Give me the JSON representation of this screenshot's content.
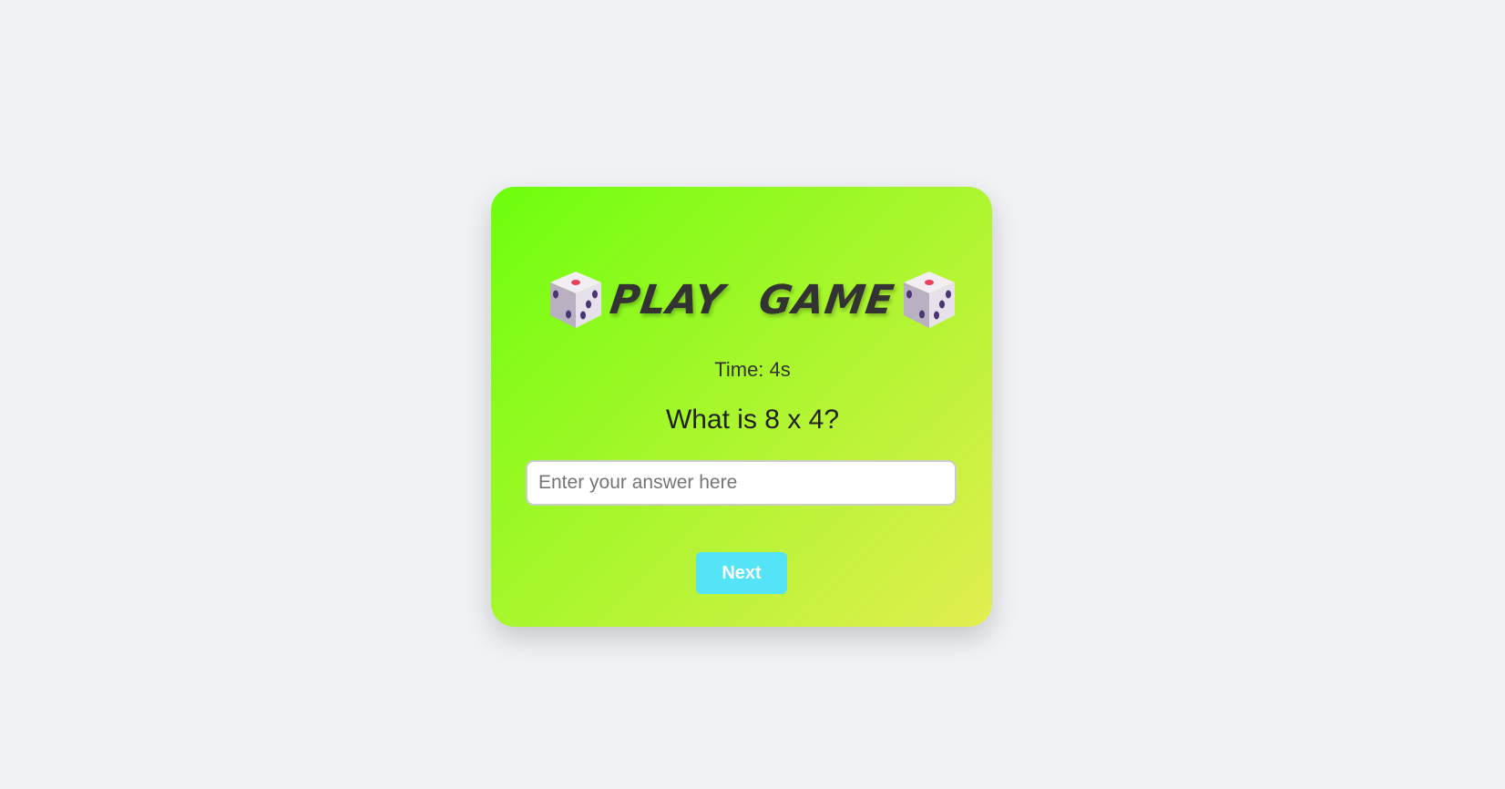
{
  "game": {
    "title": "PLAY GAME",
    "title_icons": [
      "dice-icon",
      "dice-icon"
    ],
    "timer": "Time: 4s",
    "question": "What is 8 x 4?",
    "answer_value": "",
    "answer_placeholder": "Enter your answer here",
    "next_label": "Next"
  },
  "colors": {
    "page_background": "#f0f2f5",
    "card_gradient_start": "#6dff0d",
    "card_gradient_end": "#e2ee50",
    "button": "#55e3f8",
    "text": "#333333"
  }
}
